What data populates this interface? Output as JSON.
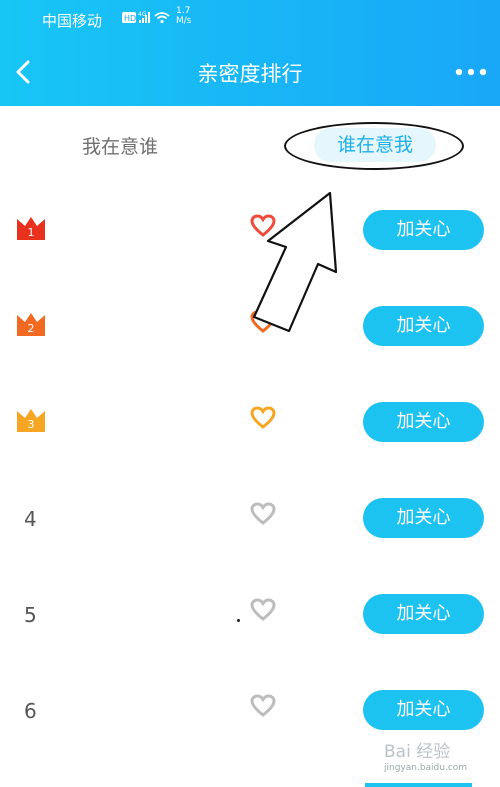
{
  "status_bar": {
    "carrier": "中国移动",
    "hd_badge": "HD",
    "network": "4G",
    "speed_value": "1.7",
    "speed_unit": "M/s"
  },
  "header": {
    "title": "亲密度排行",
    "back_icon": "chevron-left-icon",
    "more_icon": "more-dots-icon"
  },
  "tabs": [
    {
      "label": "我在意谁",
      "active": false
    },
    {
      "label": "谁在意我",
      "active": true
    }
  ],
  "list": [
    {
      "rank": "1",
      "rank_style": "crown",
      "crown_color": "#e8321e",
      "heart_color": "#f04a3a",
      "button": "加关心"
    },
    {
      "rank": "2",
      "rank_style": "crown",
      "crown_color": "#f26a21",
      "heart_color": "#f26a21",
      "button": "加关心"
    },
    {
      "rank": "3",
      "rank_style": "crown",
      "crown_color": "#f6a623",
      "heart_color": "#f6a623",
      "button": "加关心"
    },
    {
      "rank": "4",
      "rank_style": "number",
      "heart_color": "#bdbdbd",
      "button": "加关心"
    },
    {
      "rank": "5",
      "rank_style": "number",
      "heart_color": "#bdbdbd",
      "button": "加关心"
    },
    {
      "rank": "6",
      "rank_style": "number",
      "heart_color": "#bdbdbd",
      "button": "加关心"
    }
  ],
  "colors": {
    "header_start": "#17c6f5",
    "header_end": "#19a7f8",
    "button": "#1cc3f0",
    "active_tab_text": "#1fb0ea"
  },
  "watermark": {
    "brand": "Bai 经验",
    "url": "jingyan.baidu.com"
  }
}
